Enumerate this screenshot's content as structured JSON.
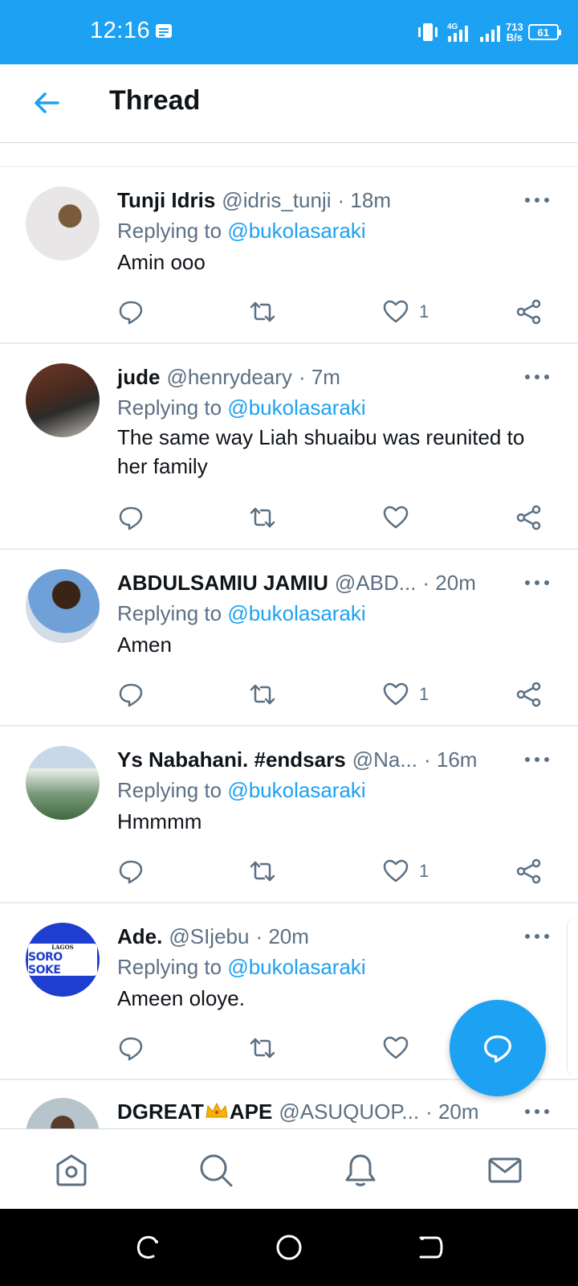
{
  "status_bar": {
    "time": "12:16",
    "network": "4G",
    "speed_value": "713",
    "speed_unit": "B/s",
    "battery": "61"
  },
  "header": {
    "title": "Thread"
  },
  "colors": {
    "brand": "#1da1f2",
    "secondary_text": "#5b7083",
    "primary_text": "#0f1419"
  },
  "tweets": [
    {
      "name": "Tunji Idris",
      "handle": "@idris_tunji",
      "time": "· 18m",
      "replying_prefix": "Replying to",
      "replying_to": "@bukolasaraki",
      "text": "Amin ooo",
      "likes": "1"
    },
    {
      "name": "jude",
      "handle": "@henrydeary",
      "time": "· 7m",
      "replying_prefix": "Replying to",
      "replying_to": "@bukolasaraki",
      "text": "The same way Liah shuaibu  was reunited to her family",
      "likes": ""
    },
    {
      "name": "ABDULSAMIU JAMIU",
      "handle": "@ABD...",
      "time": "· 20m",
      "replying_prefix": "Replying to",
      "replying_to": "@bukolasaraki",
      "text": "Amen",
      "likes": "1"
    },
    {
      "name": "Ys Nabahani. #endsars",
      "handle": "@Na...",
      "time": "· 16m",
      "replying_prefix": "Replying to",
      "replying_to": "@bukolasaraki",
      "text": "Hmmmm",
      "likes": "1"
    },
    {
      "name": "Ade.",
      "handle": "@SIjebu",
      "time": "· 20m",
      "replying_prefix": "Replying to",
      "replying_to": "@bukolasaraki",
      "text": "Ameen oloye.",
      "likes": "",
      "avatar_text_top": "LAGOS",
      "avatar_text_main": "SORO SOKE"
    },
    {
      "name_part1": "DGREAT",
      "name_part2": "APE",
      "handle": "@ASUQUOP...",
      "time": "· 20m"
    }
  ],
  "icons": {
    "reply": "reply-icon",
    "retweet": "retweet-icon",
    "like": "heart-icon",
    "share": "share-icon",
    "compose": "compose-reply-icon",
    "home": "home-icon",
    "search": "search-icon",
    "notifications": "bell-icon",
    "messages": "mail-icon"
  }
}
